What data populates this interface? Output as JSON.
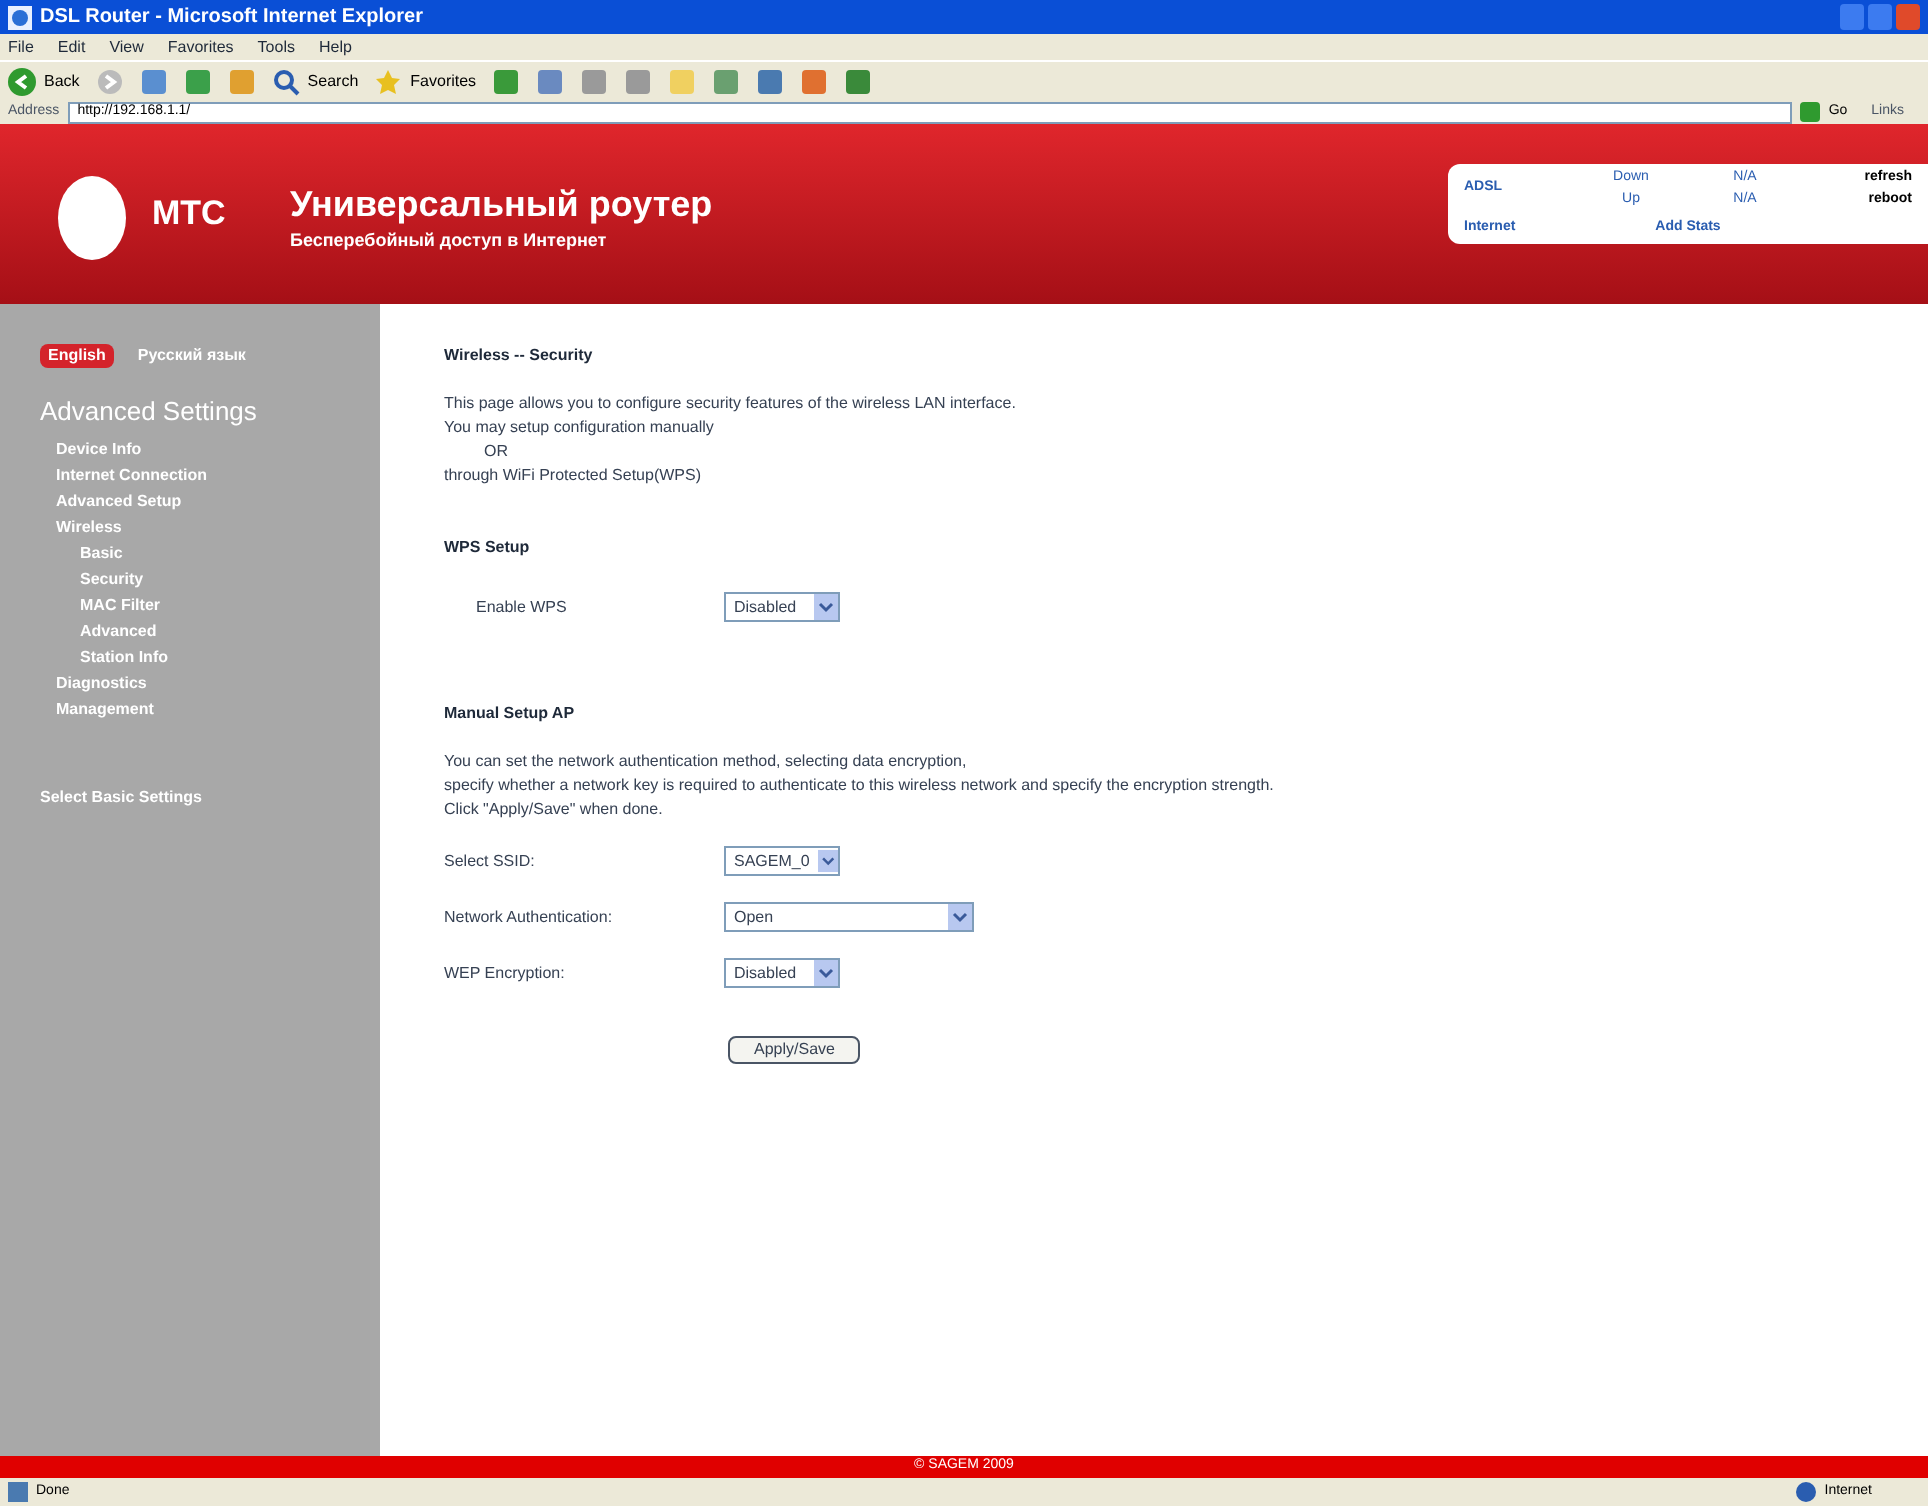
{
  "window": {
    "title": "DSL Router - Microsoft Internet Explorer"
  },
  "menu": [
    "File",
    "Edit",
    "View",
    "Favorites",
    "Tools",
    "Help"
  ],
  "toolbar": {
    "back": "Back",
    "search": "Search",
    "favorites": "Favorites"
  },
  "address_bar": {
    "label": "Address",
    "value": "http://192.168.1.1/",
    "go": "Go",
    "links": "Links"
  },
  "header": {
    "logo": "МТС",
    "title": "Универсальный роутер",
    "subtitle": "Бесперебойный доступ в Интернет",
    "status": {
      "adsl": "ADSL",
      "down": "Down",
      "up": "Up",
      "down_value": "N/A",
      "up_value": "N/A",
      "internet": "Internet",
      "stats": "Add Stats",
      "refresh": "refresh",
      "reboot": "reboot"
    }
  },
  "sidebar": {
    "languages": [
      {
        "label": "English",
        "selected": true
      },
      {
        "label": "Русский язык",
        "selected": false
      }
    ],
    "heading": "Advanced Settings",
    "items": [
      {
        "label": "Device Info"
      },
      {
        "label": "Internet Connection"
      },
      {
        "label": "Advanced Setup"
      },
      {
        "label": "Wireless",
        "children": [
          {
            "label": "Basic"
          },
          {
            "label": "Security"
          },
          {
            "label": "MAC Filter"
          },
          {
            "label": "Advanced"
          },
          {
            "label": "Station Info"
          }
        ]
      },
      {
        "label": "Diagnostics"
      },
      {
        "label": "Management"
      }
    ],
    "footer_link": "Select Basic Settings"
  },
  "content": {
    "title": "Wireless -- Security",
    "intro": [
      "This page allows you to configure security features of the wireless LAN interface.",
      "You may setup configuration manually",
      "OR",
      "through WiFi Protected Setup(WPS)"
    ],
    "wps": {
      "heading": "WPS Setup",
      "label": "Enable WPS",
      "value": "Disabled"
    },
    "manual": {
      "heading": "Manual Setup AP",
      "text": [
        "You can set the network authentication method, selecting data encryption,",
        "specify whether a network key is required to authenticate to this wireless network and specify the encryption strength.",
        "Click \"Apply/Save\" when done."
      ],
      "fields": [
        {
          "label": "Select SSID:",
          "value": "SAGEM_0",
          "kind": "narrow"
        },
        {
          "label": "Network Authentication:",
          "value": "Open",
          "kind": "wide"
        },
        {
          "label": "WEP Encryption:",
          "value": "Disabled",
          "kind": "narrow"
        }
      ],
      "button": "Apply/Save"
    }
  },
  "footer": "© SAGEM 2009",
  "status_bar": {
    "left": "Done",
    "right": "Internet"
  }
}
